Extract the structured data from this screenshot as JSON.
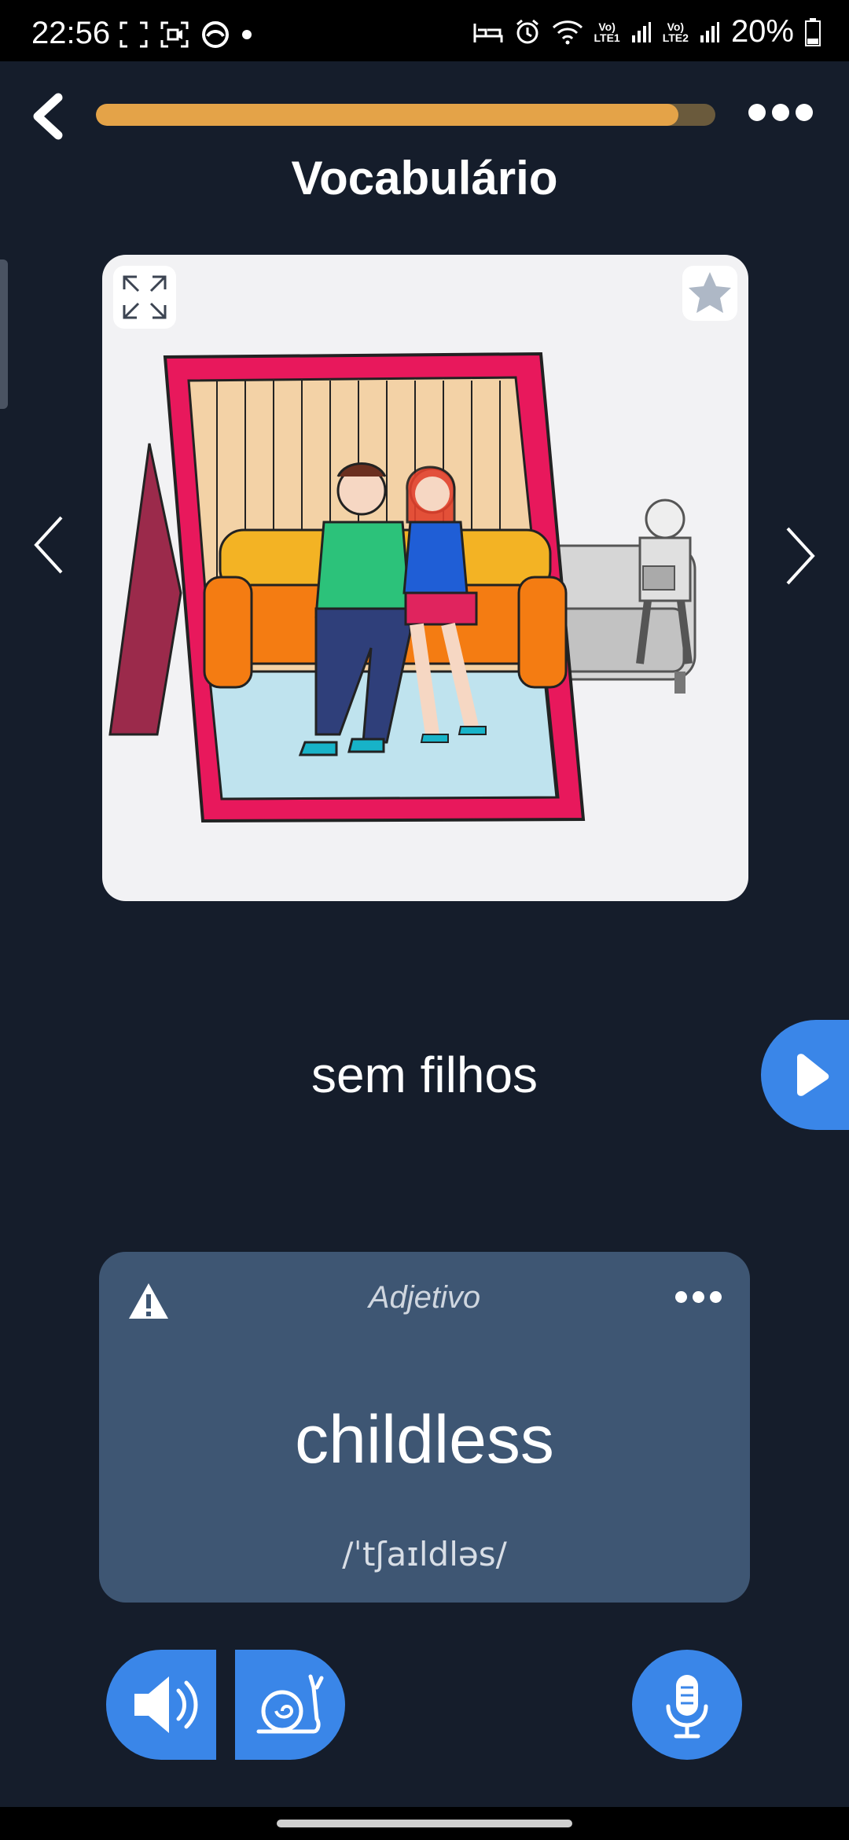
{
  "status_bar": {
    "time": "22:56",
    "net1": "Vo)\nLTE1",
    "net2": "Vo)\nLTE2",
    "battery": "20%"
  },
  "header": {
    "title": "Vocabulário",
    "progress_fraction": 0.94
  },
  "word": {
    "portuguese": "sem filhos"
  },
  "translation": {
    "part_of_speech": "Adjetivo",
    "english": "childless",
    "phonetic": "/ˈtʃaɪldləs/"
  },
  "icons": {
    "back": "chevron-left-icon",
    "more": "more-horizontal-icon",
    "expand": "expand-icon",
    "star": "star-icon",
    "prev": "chevron-left-icon",
    "next": "chevron-right-icon",
    "play": "play-icon",
    "warning": "warning-icon",
    "speaker": "speaker-icon",
    "slow": "snail-icon",
    "mic": "microphone-icon"
  },
  "colors": {
    "background": "#151d2b",
    "progress": "#e4a348",
    "accent": "#3a86e8",
    "card": "#3e5673"
  }
}
